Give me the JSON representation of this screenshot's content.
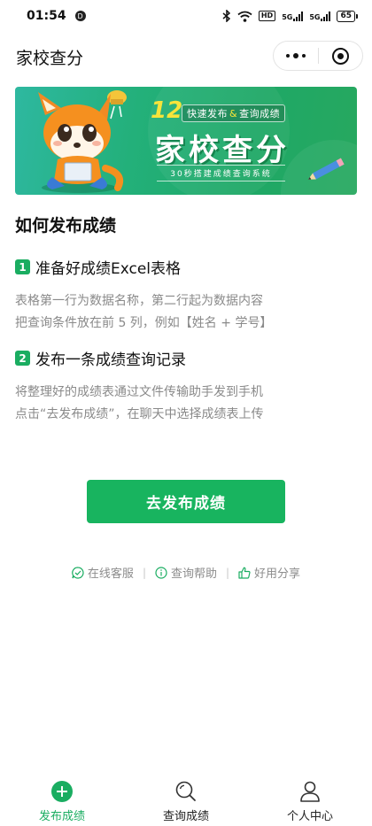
{
  "status_bar": {
    "time": "01:54",
    "notification_badge": "D",
    "hd_label": "HD",
    "signal_1": "5G",
    "signal_2": "5G",
    "battery": "65"
  },
  "nav": {
    "title": "家校查分"
  },
  "banner": {
    "number": "12",
    "tag_left": "快速发布",
    "tag_amp": "&",
    "tag_right": "查询成绩",
    "title": "家校查分",
    "caption": "30秒搭建成绩查询系统"
  },
  "content": {
    "section_title": "如何发布成绩",
    "steps": [
      {
        "number": "1",
        "title": "准备好成绩Excel表格",
        "lines": [
          "表格第一行为数据名称，第二行起为数据内容",
          "把查询条件放在前 5 列，例如【姓名 + 学号】"
        ]
      },
      {
        "number": "2",
        "title": "发布一条成绩查询记录",
        "lines": [
          "将整理好的成绩表通过文件传输助手发到手机",
          "点击“去发布成绩”，在聊天中选择成绩表上传"
        ]
      }
    ],
    "publish_button": "去发布成绩"
  },
  "help_links": {
    "service": "在线客服",
    "help": "查询帮助",
    "share": "好用分享",
    "separator": "|"
  },
  "tabs": [
    {
      "label": "发布成绩",
      "icon": "plus-circle-icon",
      "active": true
    },
    {
      "label": "查询成绩",
      "icon": "search-icon",
      "active": false
    },
    {
      "label": "个人中心",
      "icon": "user-icon",
      "active": false
    }
  ],
  "colors": {
    "accent": "#1aad61",
    "button": "#18b45f",
    "muted_text": "#8a8a8a"
  }
}
